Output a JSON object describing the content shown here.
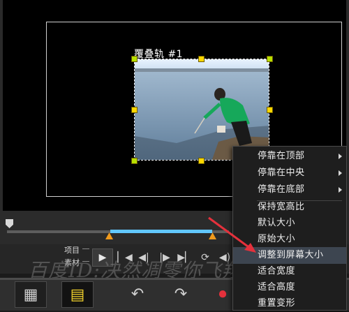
{
  "preview": {
    "track_label": "覆叠轨 #1"
  },
  "playback": {
    "label_project": "项目",
    "label_clip": "素材",
    "play_glyph": "▶",
    "buttons": [
      "▏◀",
      "◀|",
      "|▶",
      "▶▏",
      "⟳",
      "◀)"
    ]
  },
  "context_menu": {
    "items": [
      {
        "label": "停靠在顶部",
        "submenu": true
      },
      {
        "label": "停靠在中央",
        "submenu": true
      },
      {
        "label": "停靠在底部",
        "submenu": true
      },
      {
        "label": "保持宽高比",
        "submenu": false
      },
      {
        "label": "默认大小",
        "submenu": false
      },
      {
        "label": "原始大小",
        "submenu": false
      },
      {
        "label": "调整到屏幕大小",
        "submenu": false
      },
      {
        "label": "适合宽度",
        "submenu": false
      },
      {
        "label": "适合高度",
        "submenu": false
      },
      {
        "label": "重置变形",
        "submenu": false
      }
    ],
    "highlighted_index": 6
  },
  "toolbar": {
    "storyboard_icon": "▦",
    "timeline_icon": "▤",
    "undo_icon": "↶",
    "redo_icon": "↷",
    "record_icon": "⏺"
  },
  "watermark": "百度ID:决然凋零你飞翔",
  "colors": {
    "accent_orange": "#f09a1c",
    "range_blue": "#62c7ff",
    "handle_yellow": "#ffd800",
    "arrow_red": "#e4313c"
  }
}
